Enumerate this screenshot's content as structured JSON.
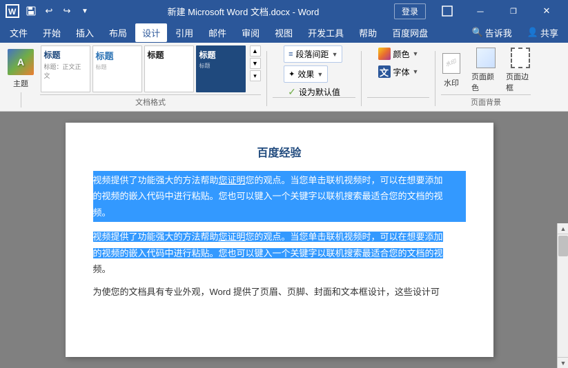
{
  "titlebar": {
    "title": "新建 Microsoft Word 文档.docx - Word",
    "app": "Word",
    "login_label": "登录",
    "quick_access": [
      "save",
      "undo",
      "redo",
      "customize"
    ],
    "window_controls": [
      "minimize",
      "restore",
      "close"
    ]
  },
  "menubar": {
    "items": [
      "文件",
      "开始",
      "插入",
      "布局",
      "设计",
      "引用",
      "邮件",
      "审阅",
      "视图",
      "开发工具",
      "帮助",
      "百度网盘"
    ],
    "active": "设计",
    "extra": [
      "告诉我",
      "共享"
    ]
  },
  "ribbon": {
    "theme_label": "主题",
    "styles": [
      {
        "label": "标题",
        "type": "heading"
      },
      {
        "label": "标题",
        "type": "heading2"
      },
      {
        "label": "标题",
        "type": "heading3"
      },
      {
        "label": "标题",
        "type": "colored"
      }
    ],
    "section_label_formats": "文档格式",
    "colors_label": "颜色",
    "fonts_label": "字体",
    "effects_label": "效果",
    "set_default_label": "设为默认值",
    "paragraph_spacing_label": "段落间距",
    "section_label_pagebg": "页面背景",
    "watermark_label": "水印",
    "page_color_label": "页面颜色",
    "page_border_label": "页面边框"
  },
  "document": {
    "title": "百度经验",
    "paragraphs": [
      {
        "text": "视频提供了功能强大的方法帮助您证明您的观点。当您单击联机视频时，可以在想要添加的视频的嵌入代码中进行粘贴。您也可以键入一个关键字以联机搜索最适合您的文档的视频。",
        "selected": true
      },
      {
        "text": "视频提供了功能强大的方法帮助您证明您的观点。当您单击联机视频时，可以在想要添加的视频的嵌入代码中进行粘贴。您也可以键入一个关键字以联机搜索最适合您的文档的视频。",
        "selected": false,
        "partial_selected": true
      },
      {
        "text": "为使您的文档具有专业外观，Word 提供了页眉、页脚、封面和文本框设计，这些设计可",
        "selected": false
      }
    ]
  }
}
